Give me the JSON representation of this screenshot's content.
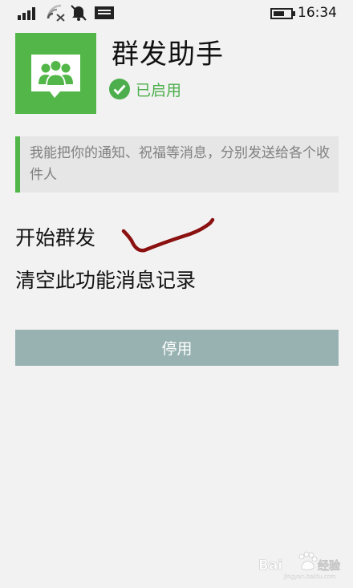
{
  "status_bar": {
    "time": "16:34",
    "icons": [
      "signal-icon",
      "wifi-icon",
      "notification-off-icon",
      "message-icon",
      "battery-icon"
    ]
  },
  "app": {
    "title": "群发助手",
    "status": "已启用",
    "icon": "group-chat-icon",
    "description": "我能把你的通知、祝福等消息，分别发送给各个收件人"
  },
  "menu": {
    "start_label": "开始群发",
    "clear_label": "清空此功能消息记录"
  },
  "actions": {
    "disable_label": "停用"
  },
  "colors": {
    "brand_green": "#52b748",
    "status_green": "#4cae4c",
    "button_bg": "#98b2b1",
    "desc_bg": "#e6e6e6",
    "page_bg": "#f2f2f2",
    "annotation_red": "#8b1010"
  }
}
